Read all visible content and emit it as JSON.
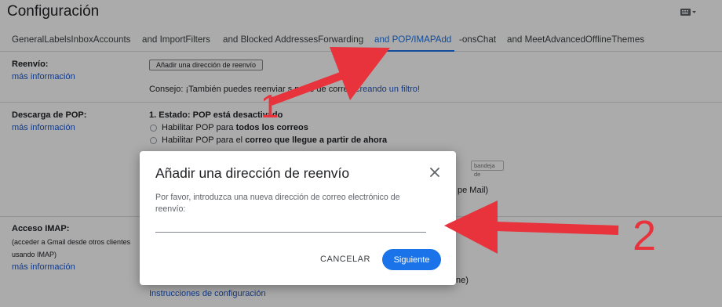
{
  "page": {
    "title": "Configuración",
    "keyboard_icon": "keyboard-icon"
  },
  "tabs": [
    {
      "label": "General"
    },
    {
      "label": "Labels"
    },
    {
      "label": "Inbox"
    },
    {
      "label": "Accounts and Import"
    },
    {
      "label": "Filters and Blocked Addresses"
    },
    {
      "label": "Forwarding and POP/IMAP",
      "active": true
    },
    {
      "label": "Add-ons"
    },
    {
      "label": "Chat and Meet"
    },
    {
      "label": "Advanced"
    },
    {
      "label": "Offline"
    },
    {
      "label": "Themes"
    }
  ],
  "tabs_rendered": [
    "GeneralLabelsInboxAccounts",
    "and ImportFilters",
    "and Blocked AddressesForwarding",
    "and POP/IMAPAdd",
    "-onsChat",
    "and MeetAdvancedOfflineThemes"
  ],
  "forwarding": {
    "label": "Reenvío:",
    "more_info": "más información",
    "add_button": "Añadir una dirección de reenvío",
    "tip_prefix": "Consejo: ¡También puedes reenviar s",
    "tip_mid": "parte de",
    "tip_mid2": "correo",
    "tip_link": "creando un filtro!"
  },
  "pop": {
    "label": "Descarga de POP:",
    "more_info": "más información",
    "status_prefix": "1. Estado: ",
    "status_value": "POP está desactivado",
    "option1_prefix": "Habilitar POP para ",
    "option1_bold": "todos los correos",
    "option2_prefix": "Habilitar POP para el ",
    "option2_bold": "correo que llegue a partir de ahora",
    "partial_select": "bandeja de",
    "partial_text": "pe Mail)"
  },
  "imap": {
    "label": "Acceso IMAP:",
    "desc_line1": "(acceder a Gmail desde otros clientes",
    "desc_line2": "usando IMAP)",
    "more_info": "más información",
    "partial_text": "ne)",
    "instructions_link": "Instrucciones de configuración"
  },
  "dialog": {
    "title": "Añadir una dirección de reenvío",
    "prompt": "Por favor, introduzca una nueva dirección de correo electrónico de reenvío:",
    "input_value": "",
    "input_placeholder": "",
    "cancel_label": "CANCELAR",
    "next_label": "Siguiente",
    "close_icon": "close-icon"
  },
  "annotations": {
    "number1": "1",
    "number2": "2",
    "color": "#e8323c"
  },
  "colors": {
    "accent": "#1a73e8",
    "link": "#1a56c9",
    "scrim": "rgba(0,0,0,0.33)"
  }
}
